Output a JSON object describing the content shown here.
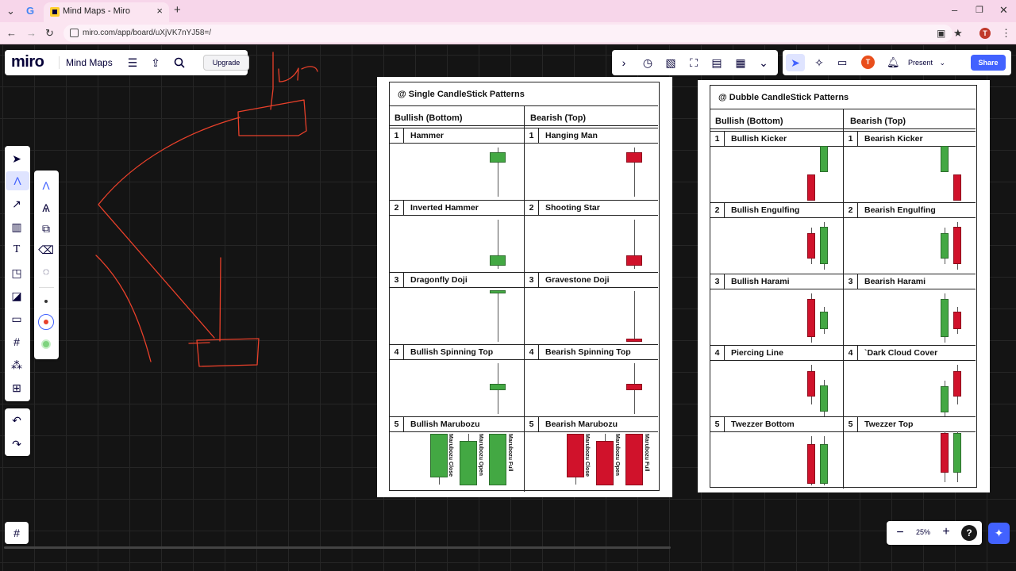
{
  "browser": {
    "tab_title": "Mind Maps - Miro",
    "url": "miro.com/app/board/uXjVK7nYJ58=/",
    "profile_initial": "T"
  },
  "toolbar": {
    "logo": "miro",
    "board_name": "Mind Maps",
    "upgrade_label": "Upgrade",
    "present_label": "Present",
    "share_label": "Share",
    "user_initial": "T"
  },
  "zoom": {
    "level": "25%"
  },
  "colors": {
    "accent": "#4262ff",
    "bull": "#43a843",
    "bear": "#d0122b",
    "pen": "#e8402a",
    "tab_bg": "#f7d6ea"
  },
  "single_sheet": {
    "title": "@ Single CandleStick Patterns",
    "bull_header": "Bullish (Bottom)",
    "bear_header": "Bearish (Top)",
    "bull_rows": [
      {
        "num": "1",
        "name": "Hammer"
      },
      {
        "num": "2",
        "name": "Inverted Hammer"
      },
      {
        "num": "3",
        "name": "Dragonfly Doji"
      },
      {
        "num": "4",
        "name": "Bullish Spinning Top"
      },
      {
        "num": "5",
        "name": "Bullish Marubozu"
      }
    ],
    "bear_rows": [
      {
        "num": "1",
        "name": "Hanging Man"
      },
      {
        "num": "2",
        "name": "Shooting Star"
      },
      {
        "num": "3",
        "name": "Gravestone Doji"
      },
      {
        "num": "4",
        "name": "Bearish Spinning Top"
      },
      {
        "num": "5",
        "name": "Bearish Marubozu"
      }
    ],
    "marubozu_labels": [
      "Marubozu Close",
      "Marubozu Open",
      "Marubozu Full"
    ]
  },
  "double_sheet": {
    "title": "@ Dubble CandleStick Patterns",
    "bull_header": "Bullish (Bottom)",
    "bear_header": "Bearish (Top)",
    "bull_rows": [
      {
        "num": "1",
        "name": "Bullish Kicker"
      },
      {
        "num": "2",
        "name": "Bullish Engulfing"
      },
      {
        "num": "3",
        "name": "Bullish Harami"
      },
      {
        "num": "4",
        "name": "Piercing Line"
      },
      {
        "num": "5",
        "name": "Twezzer Bottom"
      }
    ],
    "bear_rows": [
      {
        "num": "1",
        "name": "Bearish Kicker"
      },
      {
        "num": "2",
        "name": "Bearish Engulfing"
      },
      {
        "num": "3",
        "name": "Bearish Harami"
      },
      {
        "num": "4",
        "name": "`Dark Cloud Cover"
      },
      {
        "num": "5",
        "name": "Twezzer Top"
      }
    ]
  },
  "icons": {
    "left_tools": [
      "select-icon",
      "pen-icon",
      "connector-icon",
      "templates-icon",
      "text-icon",
      "sticky-note-icon",
      "shapes-icon",
      "comment-icon",
      "frame-icon",
      "mindmap-icon",
      "add-icon"
    ],
    "pen_tools": [
      "pen-tool-icon",
      "highlighter-icon",
      "shape-pen-icon",
      "eraser-icon",
      "lasso-icon"
    ]
  }
}
